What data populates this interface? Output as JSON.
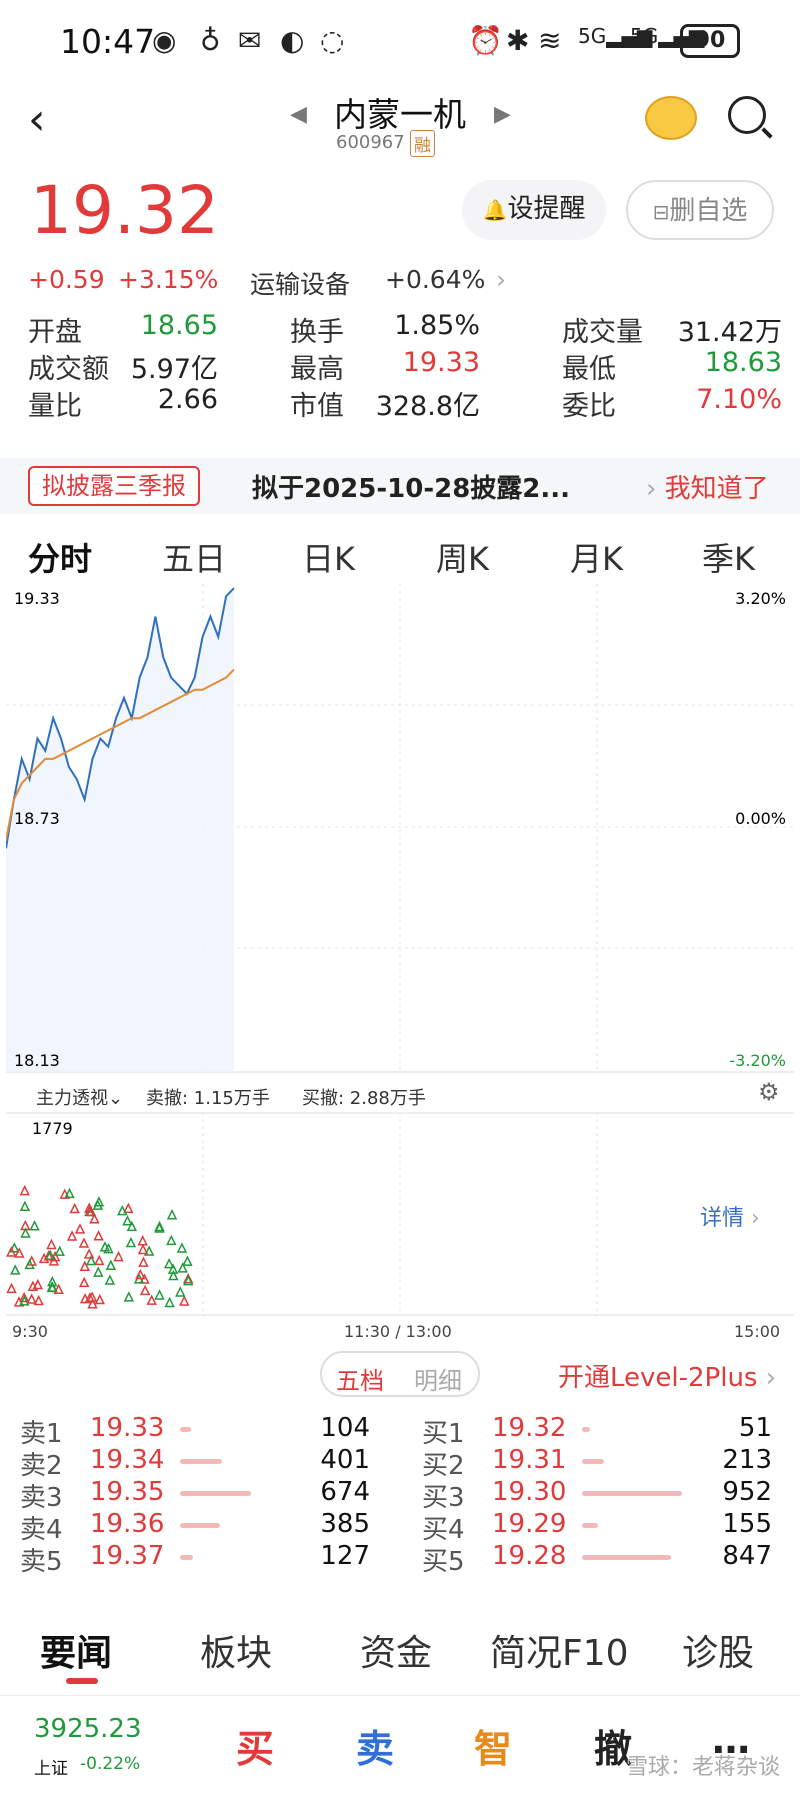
{
  "status": {
    "time": "10:47",
    "battery": "90"
  },
  "header": {
    "title": "内蒙一机",
    "code": "600967",
    "margin_badge": "融"
  },
  "quote": {
    "price": "19.32",
    "change": "+0.59",
    "change_pct": "+3.15%",
    "sector": "运输设备",
    "sector_pct": "+0.64%"
  },
  "buttons": {
    "remind": "设提醒",
    "remove": "删自选"
  },
  "stats": [
    {
      "label": "开盘",
      "value": "18.65",
      "color": "#1f9a3a"
    },
    {
      "label": "换手",
      "value": "1.85%",
      "color": "#222"
    },
    {
      "label": "成交量",
      "value": "31.42万",
      "color": "#222"
    },
    {
      "label": "成交额",
      "value": "5.97亿",
      "color": "#222"
    },
    {
      "label": "最高",
      "value": "19.33",
      "color": "#e03a3a"
    },
    {
      "label": "最低",
      "value": "18.63",
      "color": "#1f9a3a"
    },
    {
      "label": "量比",
      "value": "2.66",
      "color": "#222"
    },
    {
      "label": "市值",
      "value": "328.8亿",
      "color": "#222"
    },
    {
      "label": "委比",
      "value": "7.10%",
      "color": "#e03a3a"
    }
  ],
  "notice": {
    "tag": "拟披露三季报",
    "text": "拟于2025-10-28披露2...",
    "action": "我知道了"
  },
  "chart_tabs": [
    "分时",
    "五日",
    "日K",
    "周K",
    "月K",
    "季K"
  ],
  "chart_labels": {
    "top_left": "19.33",
    "mid_left": "18.73",
    "bottom_left": "18.13",
    "top_right": "3.20%",
    "mid_right": "0.00%",
    "bottom_right": "-3.20%"
  },
  "chart_data": {
    "type": "line",
    "ylim": [
      18.13,
      19.33
    ],
    "series": [
      {
        "values": [
          18.68,
          18.8,
          18.9,
          18.85,
          18.95,
          18.92,
          19.0,
          18.95,
          18.88,
          18.85,
          18.8,
          18.9,
          18.95,
          18.93,
          19.0,
          19.05,
          19.0,
          19.1,
          19.15,
          19.25,
          19.15,
          19.1,
          19.08,
          19.06,
          19.1,
          19.2,
          19.25,
          19.2,
          19.3,
          19.32
        ]
      },
      {
        "values": [
          18.7,
          18.8,
          18.84,
          18.86,
          18.88,
          18.9,
          18.9,
          18.91,
          18.92,
          18.93,
          18.94,
          18.95,
          18.96,
          18.97,
          18.98,
          18.99,
          19.0,
          19.0,
          19.01,
          19.02,
          19.03,
          19.04,
          19.05,
          19.06,
          19.07,
          19.07,
          19.08,
          19.09,
          19.1,
          19.12
        ]
      }
    ]
  },
  "flow": {
    "label": "主力透视",
    "sell_cancel": "卖撤: 1.15万手",
    "buy_cancel": "买撤: 2.88万手"
  },
  "volume": {
    "max": "1779",
    "detail": "详情"
  },
  "time_axis": {
    "start": "9:30",
    "mid": "11:30 / 13:00",
    "end": "15:00"
  },
  "orderbook": {
    "tab_active": "五档",
    "tab_other": "明细",
    "level2": "开通Level-2Plus",
    "sells": [
      {
        "label": "卖1",
        "price": "19.33",
        "vol": "104",
        "bar": 0.11
      },
      {
        "label": "卖2",
        "price": "19.34",
        "vol": "401",
        "bar": 0.42
      },
      {
        "label": "卖3",
        "price": "19.35",
        "vol": "674",
        "bar": 0.71
      },
      {
        "label": "卖4",
        "price": "19.36",
        "vol": "385",
        "bar": 0.4
      },
      {
        "label": "卖5",
        "price": "19.37",
        "vol": "127",
        "bar": 0.13
      }
    ],
    "buys": [
      {
        "label": "买1",
        "price": "19.32",
        "vol": "51",
        "bar": 0.05
      },
      {
        "label": "买2",
        "price": "19.31",
        "vol": "213",
        "bar": 0.22
      },
      {
        "label": "买3",
        "price": "19.30",
        "vol": "952",
        "bar": 1.0
      },
      {
        "label": "买4",
        "price": "19.29",
        "vol": "155",
        "bar": 0.16
      },
      {
        "label": "买5",
        "price": "19.28",
        "vol": "847",
        "bar": 0.89
      }
    ]
  },
  "news_tabs": [
    "要闻",
    "板块",
    "资金",
    "简况F10",
    "诊股"
  ],
  "index": {
    "value": "3925.23",
    "name": "上证",
    "change": "-0.22%"
  },
  "actions": [
    "买",
    "卖",
    "智",
    "撤",
    "…"
  ],
  "watermark": "雪球：老蒋杂谈"
}
